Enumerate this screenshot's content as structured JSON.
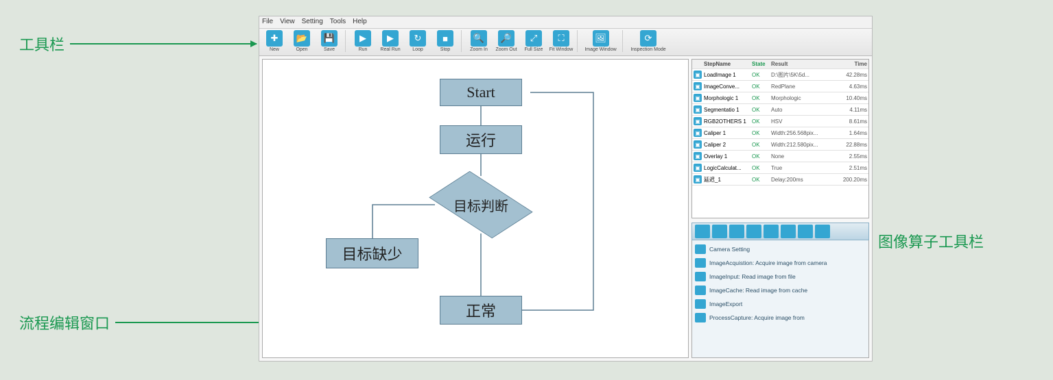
{
  "annotations": {
    "toolbar": "工具栏",
    "flow_editor": "流程编辑窗口",
    "image_operator_toolbar": "图像算子工具栏"
  },
  "menubar": {
    "file": "File",
    "view": "View",
    "setting": "Setting",
    "tools": "Tools",
    "help": "Help"
  },
  "toolbar": {
    "new": "New",
    "open": "Open",
    "save": "Save",
    "run": "Run",
    "realrun": "Real Run",
    "loop": "Loop",
    "stop": "Stop",
    "zoomin": "Zoom In",
    "zoomout": "Zoom Out",
    "fullsize": "Full Size",
    "fitwindow": "Fit Window",
    "imagewindow": "Image Window",
    "inspectionmode": "Inspection Mode"
  },
  "flowchart": {
    "start": "Start",
    "run": "运行",
    "decision": "目标判断",
    "missing": "目标缺少",
    "normal": "正常"
  },
  "grid": {
    "headers": {
      "name": "StepName",
      "state": "State",
      "result": "Result",
      "time": "Time"
    },
    "rows": [
      {
        "icon": "img",
        "name": "LoadImage 1",
        "state": "OK",
        "result": "D:\\图片\\5K\\5d...",
        "time": "42.28ms"
      },
      {
        "icon": "img",
        "name": "ImageConve...",
        "state": "OK",
        "result": "RedPlane",
        "time": "4.63ms"
      },
      {
        "icon": "img",
        "name": "Morphologic 1",
        "state": "OK",
        "result": "Morphologic",
        "time": "10.40ms"
      },
      {
        "icon": "img",
        "name": "Segmentatio 1",
        "state": "OK",
        "result": "Auto",
        "time": "4.11ms"
      },
      {
        "icon": "img",
        "name": "RGB2OTHERS 1",
        "state": "OK",
        "result": "HSV",
        "time": "8.61ms"
      },
      {
        "icon": "img",
        "name": "Caliper 1",
        "state": "OK",
        "result": "Width:256.568pix...",
        "time": "1.64ms"
      },
      {
        "icon": "img",
        "name": "Caliper 2",
        "state": "OK",
        "result": "Width:212.580pix...",
        "time": "22.88ms"
      },
      {
        "icon": "img",
        "name": "Overlay 1",
        "state": "OK",
        "result": "None",
        "time": "2.55ms"
      },
      {
        "icon": "img",
        "name": "LogicCalculat...",
        "state": "OK",
        "result": "True",
        "time": "2.51ms"
      },
      {
        "icon": "img",
        "name": "延迟_1",
        "state": "OK",
        "result": "Delay:200ms",
        "time": "200.20ms"
      }
    ]
  },
  "oplist": {
    "items": [
      "Camera Setting",
      "ImageAcquistion: Acquire image from camera",
      "ImageInput: Read image from file",
      "ImageCache: Read image from cache",
      "ImageExport",
      "ProcessCapture: Acquire image from"
    ]
  }
}
